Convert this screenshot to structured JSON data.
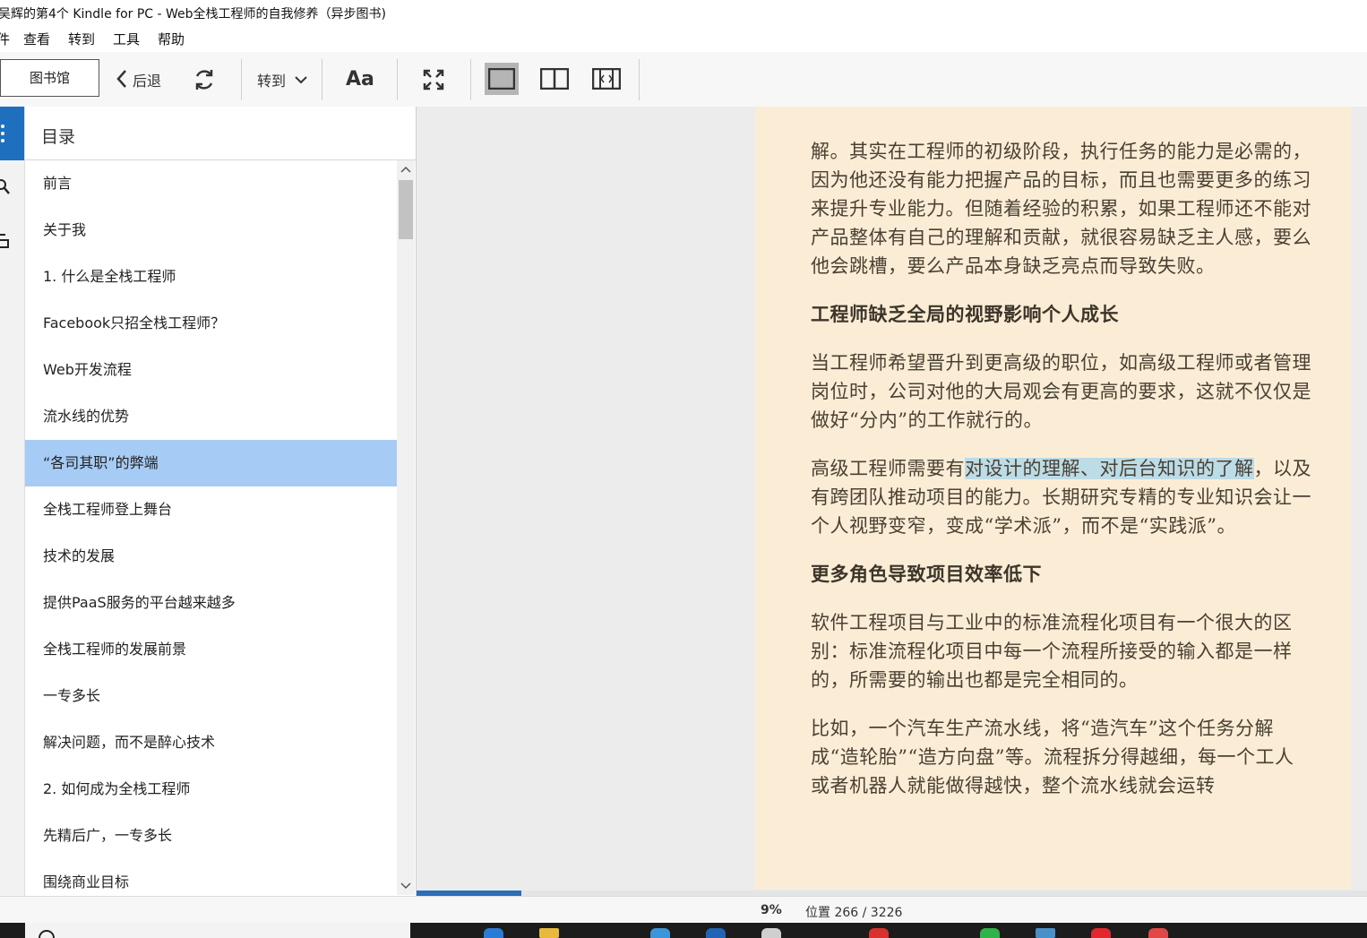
{
  "window": {
    "title": "吴辉的第4个 Kindle for PC - Web全栈工程师的自我修养（异步图书)"
  },
  "menu": [
    "件",
    "查看",
    "转到",
    "工具",
    "帮助"
  ],
  "toolbar": {
    "library_label": "图书馆",
    "back_label": "后退",
    "goto_label": "转到",
    "font_label": "Aa"
  },
  "toc": {
    "title": "目录",
    "items": [
      "前言",
      "关于我",
      "1. 什么是全栈工程师",
      "Facebook只招全栈工程师？",
      "Web开发流程",
      "流水线的优势",
      "“各司其职”的弊端",
      "全栈工程师登上舞台",
      "技术的发展",
      "提供PaaS服务的平台越来越多",
      "全栈工程师的发展前景",
      "一专多长",
      "解决问题，而不是醉心技术",
      "2. 如何成为全栈工程师",
      "先精后广，一专多长",
      "围绕商业目标"
    ],
    "selected_index": 6
  },
  "content": {
    "p1": "解。其实在工程师的初级阶段，执行任务的能力是必需的，因为他还没有能力把握产品的目标，而且也需要更多的练习来提升专业能力。但随着经验的积累，如果工程师还不能对产品整体有自己的理解和贡献，就很容易缺乏主人感，要么他会跳槽，要么产品本身缺乏亮点而导致失败。",
    "h1": "工程师缺乏全局的视野影响个人成长",
    "p2": "当工程师希望晋升到更高级的职位，如高级工程师或者管理岗位时，公司对他的大局观会有更高的要求，这就不仅仅是做好“分内”的工作就行的。",
    "p3_a": "高级工程师需要有",
    "p3_highlight": "对设计的理解、对后台知识的了解",
    "p3_b": "，以及有跨团队推动项目的能力。长期研究专精的专业知识会让一个人视野变窄，变成“学术派”，而不是“实践派”。",
    "h2": "更多角色导致项目效率低下",
    "p4": "软件工程项目与工业中的标准流程化项目有一个很大的区别：标准流程化项目中每一个流程所接受的输入都是一样的，所需要的输出也都是完全相同的。",
    "p5": "比如，一个汽车生产流水线，将“造汽车”这个任务分解成“造轮胎”“造方向盘”等。流程拆分得越细，每一个工人或者机器人就能做得越快，整个流水线就会运转"
  },
  "status": {
    "percent": "9%",
    "location": "位置 266 / 3226",
    "progress": 0.11
  },
  "colors": {
    "accent": "#1f6fbf",
    "selection": "#a6cbf4",
    "page_bg": "#fbedd5",
    "highlight": "#bcdce6"
  }
}
